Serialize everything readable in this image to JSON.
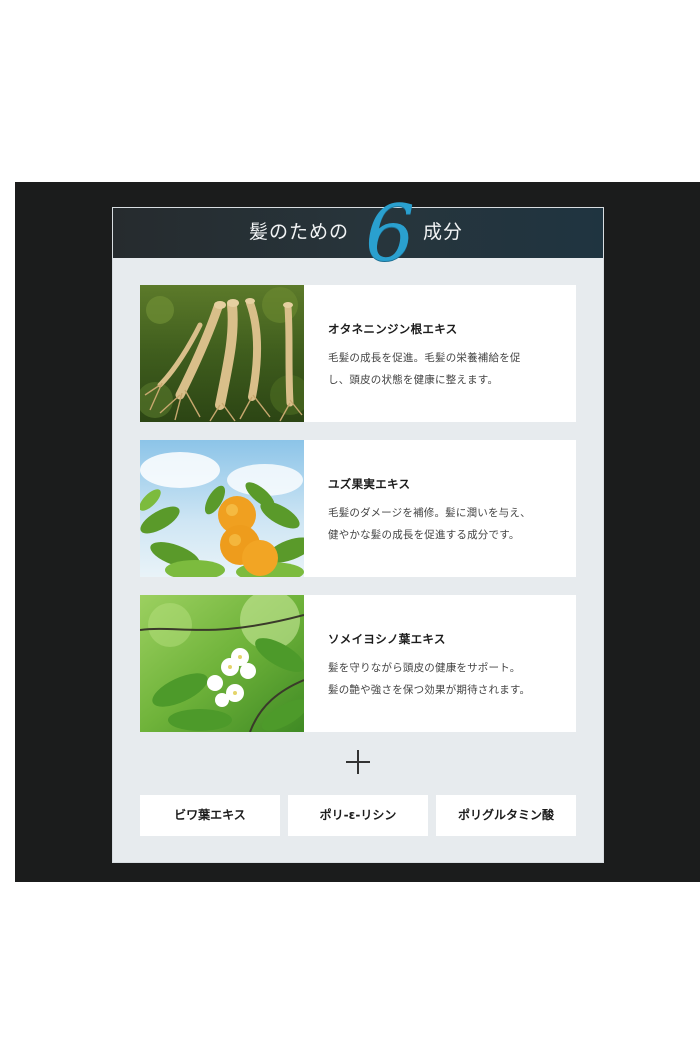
{
  "title": {
    "left": "髪のための",
    "number": "6",
    "right": "成分"
  },
  "ingredients": [
    {
      "name": "オタネニンジン根エキス",
      "desc_line1": "毛髪の成長を促進。毛髪の栄養補給を促",
      "desc_line2": "し、頭皮の状態を健康に整えます。",
      "image": "ginseng-photo"
    },
    {
      "name": "ユズ果実エキス",
      "desc_line1": "毛髪のダメージを補修。髪に潤いを与え、",
      "desc_line2": "健やかな髪の成長を促進する成分です。",
      "image": "yuzu-photo"
    },
    {
      "name": "ソメイヨシノ葉エキス",
      "desc_line1": "髪を守りながら頭皮の健康をサポート。",
      "desc_line2": "髪の艶や強さを保つ効果が期待されます。",
      "image": "cherry-blossom-photo"
    }
  ],
  "extras": [
    "ビワ葉エキス",
    "ポリ-ε-リシン",
    "ポリグルタミン酸"
  ],
  "colors": {
    "accent": "#2aa0cf",
    "band": "#1b1c1c",
    "card": "#e7ebee"
  }
}
